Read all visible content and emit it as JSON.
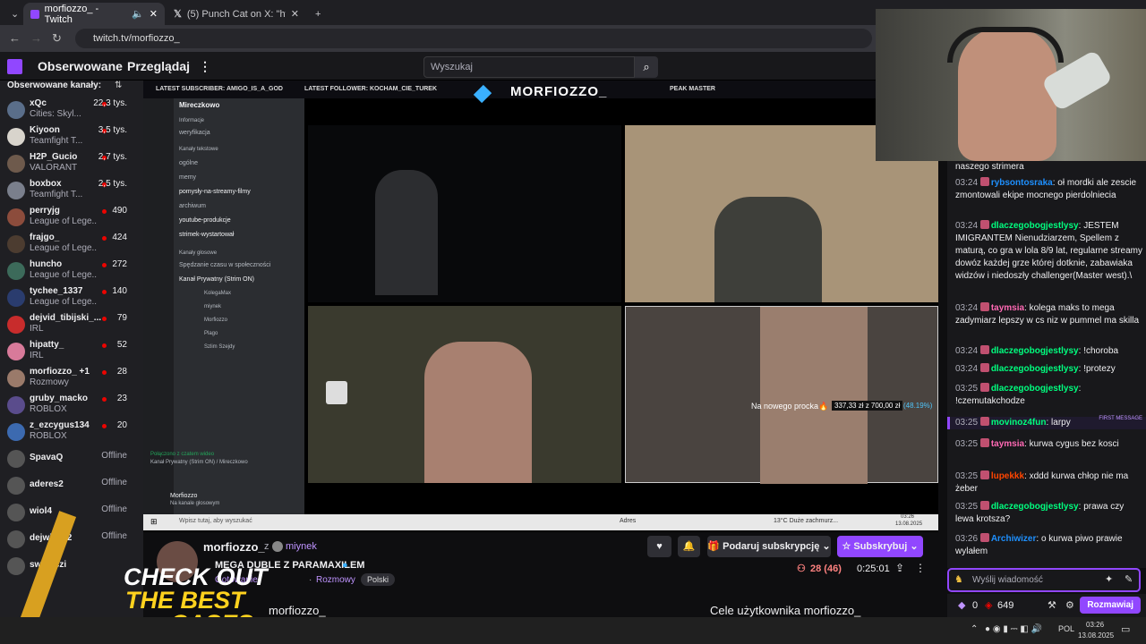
{
  "browser": {
    "tabs": [
      {
        "label": "morfiozzo_ - Twitch",
        "active": true
      },
      {
        "label": "(5) Punch Cat on X: \"https://t.c",
        "active": false
      }
    ],
    "url": "twitch.tv/morfiozzo_"
  },
  "nav": {
    "following": "Obserwowane",
    "browse": "Przeglądaj",
    "search_placeholder": "Wyszukaj"
  },
  "sidebar": {
    "title": "Obserwowane kanały:",
    "channels": [
      {
        "name": "xQc",
        "game": "Cities: Skyl...",
        "viewers": "22,3 tys.",
        "color": "#5a6e8a"
      },
      {
        "name": "Kiyoon",
        "game": "Teamfight T...",
        "viewers": "3,5 tys.",
        "color": "#d8d4cc"
      },
      {
        "name": "H2P_Gucio",
        "game": "VALORANT",
        "viewers": "2,7 tys.",
        "color": "#6e5a4c"
      },
      {
        "name": "boxbox",
        "game": "Teamfight T...",
        "viewers": "2,5 tys.",
        "color": "#7a7f8c"
      },
      {
        "name": "perryjg",
        "game": "League of Lege...",
        "viewers": "490",
        "color": "#8c4c3c"
      },
      {
        "name": "frajgo_",
        "game": "League of Lege...",
        "viewers": "424",
        "color": "#4c3c30"
      },
      {
        "name": "huncho",
        "game": "League of Lege...",
        "viewers": "272",
        "color": "#3c6a5a"
      },
      {
        "name": "tychee_1337",
        "game": "League of Lege...",
        "viewers": "140",
        "color": "#2a3c6e"
      },
      {
        "name": "dejvid_tibijski_...",
        "game": "IRL",
        "viewers": "79",
        "color": "#c82c2c"
      },
      {
        "name": "hipatty_",
        "game": "IRL",
        "viewers": "52",
        "color": "#d87a9a"
      },
      {
        "name": "morfiozzo_ +1",
        "game": "Rozmowy",
        "viewers": "28",
        "color": "#9a7a6a"
      },
      {
        "name": "gruby_macko",
        "game": "ROBLOX",
        "viewers": "23",
        "color": "#5a4c8c"
      },
      {
        "name": "z_ezcygus134",
        "game": "ROBLOX",
        "viewers": "20",
        "color": "#3c6ab0"
      },
      {
        "name": "SpavaQ",
        "game": "",
        "viewers": "Offline",
        "color": "#555"
      },
      {
        "name": "aderes2",
        "game": "",
        "viewers": "Offline",
        "color": "#555"
      },
      {
        "name": "wiol4",
        "game": "",
        "viewers": "Offline",
        "color": "#555"
      },
      {
        "name": "dejwikk92",
        "game": "",
        "viewers": "Offline",
        "color": "#555"
      },
      {
        "name": "swaniczi",
        "game": "",
        "viewers": "",
        "color": "#555"
      }
    ]
  },
  "overlay": {
    "latest_sub": "LATEST SUBSCRIBER: AMIGO_IS_A_GOD",
    "latest_follower": "LATEST FOLLOWER: KOCHAM_CIE_TUREK",
    "channel": "MORFIOZZO_",
    "rank": "PEAK MASTER",
    "goal": "Na nowego procka🔥",
    "goal_amount": "337,33 zł z 700,00 zł",
    "goal_pct": "(48.19%)"
  },
  "discord": {
    "server": "Mireczkowo",
    "groups": [
      "Informacje",
      "Kanały tekstowe",
      "Kanały głosowe"
    ],
    "channels": [
      "weryfikacja",
      "ogólne",
      "memy",
      "pomysły-na-streamy-filmy",
      "archiwum",
      "youtube-produkcje",
      "strimek-wystartował",
      "Spędzanie czasu w społeczności",
      "Kanał Prywatny (Strim ON)"
    ],
    "voice_users": [
      "KolegaMax",
      "miynek",
      "Morfiozzo",
      "Plago",
      "Szlim Szejdy"
    ],
    "connected": "Połączono z czatem wideo",
    "connected_sub": "Kanał Prywatny (Strim ON) / Mireczkowo",
    "user": "Morfiozzo",
    "user_status": "Na kanale głosowym"
  },
  "stream_taskbar": {
    "search": "Wpisz tutaj, aby wyszukać",
    "addr": "Adres",
    "weather": "13°C  Duże zachmurz...",
    "time": "03:26",
    "date": "13.08.2025"
  },
  "stream_info": {
    "streamer": "morfiozzo_",
    "with": "z",
    "guest": "miynek",
    "title": "MEGA DUBLE Z PARAMAXILEM",
    "category": "Gotowanie",
    "category2": "Rozmowy",
    "tag": "Polski",
    "viewers": "28 (46)",
    "uptime": "0:25:01",
    "gift_sub": "Podaruj subskrypcję",
    "subscribe": "Subskrybuj",
    "about": "morfiozzo_",
    "goals": "Cele użytkownika morfiozzo_"
  },
  "chat": {
    "messages": [
      {
        "ts": "",
        "user": "",
        "color": "#efeff1",
        "text": "naszego strimera"
      },
      {
        "ts": "03:24",
        "user": "rybsontosraka",
        "color": "#1e90ff",
        "text": "oł mordki ale zescie zmontowali ekipe mocnego pierdolniecia"
      },
      {
        "ts": "03:24",
        "user": "dlaczegobogjestlysy",
        "color": "#00ff7f",
        "text": "JESTEM IMIGRANTEM Nienudziarzem, Spellem z maturą, co gra w lola 8/9 lat, regularne streamy dowóz każdej grze której dotknie, zabawiaka widzów i niedoszły challenger(Master west).\\"
      },
      {
        "ts": "03:24",
        "user": "taymsia",
        "color": "#ff69b4",
        "text": "kolega maks to mega zadymiarz lepszy w cs niz w pummel ma skilla"
      },
      {
        "ts": "03:24",
        "user": "dlaczegobogjestlysy",
        "color": "#00ff7f",
        "text": "!choroba"
      },
      {
        "ts": "03:24",
        "user": "dlaczegobogjestlysy",
        "color": "#00ff7f",
        "text": "!protezy"
      },
      {
        "ts": "03:25",
        "user": "dlaczegobogjestlysy",
        "color": "#00ff7f",
        "text": "!czemutakchodze"
      },
      {
        "ts": "03:25",
        "user": "movinoz4fun",
        "color": "#00ff7f",
        "text": "larpy",
        "first": "FIRST MESSAGE"
      },
      {
        "ts": "03:25",
        "user": "taymsia",
        "color": "#ff69b4",
        "text": "kurwa cygus bez kosci"
      },
      {
        "ts": "03:25",
        "user": "lupekkk",
        "color": "#ff4500",
        "text": "xddd kurwa chłop nie ma żeber"
      },
      {
        "ts": "03:25",
        "user": "dlaczegobogjestlysy",
        "color": "#00ff7f",
        "text": "prawa czy lewa krotsza?"
      },
      {
        "ts": "03:26",
        "user": "Archiwizer",
        "color": "#1e90ff",
        "text": "o kurwa piwo prawie wylałem"
      }
    ],
    "input_placeholder": "Wyślij wiadomość",
    "points": "0",
    "bits": "649",
    "send": "Rozmawiaj"
  },
  "ad": {
    "line1": "CHECK OUT",
    "line2": "THE BEST",
    "line3": "CASES"
  },
  "windows": {
    "lang": "POL",
    "time": "03:26",
    "date": "13.08.2025"
  }
}
